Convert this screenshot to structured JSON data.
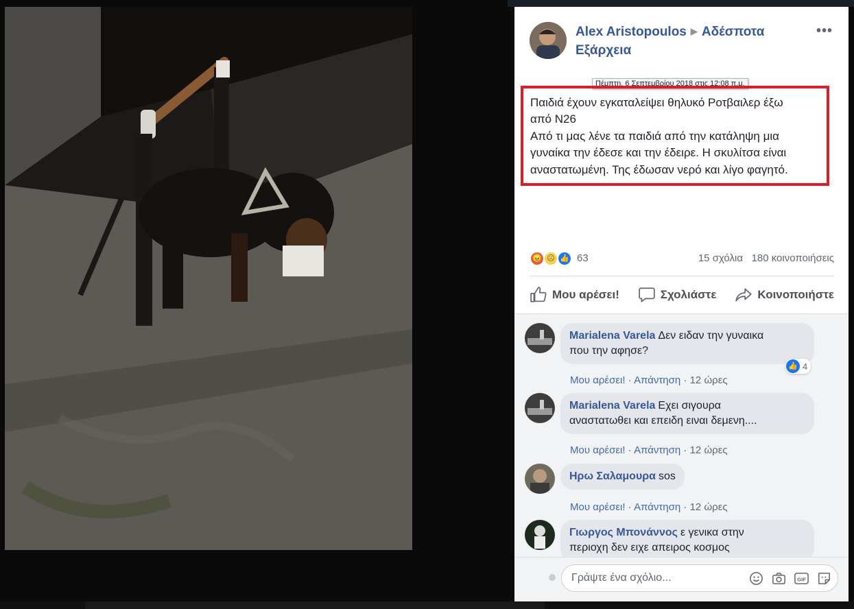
{
  "post": {
    "author": "Alex Aristopoulos",
    "group": "Αδέσποτα Εξάρχεια",
    "timestamp_tooltip": "Πέμπτη, 6 Σεπτεμβρίου 2018 στις 12:08 π.μ.",
    "more_icon": "more-horizontal-icon",
    "text_lines": [
      "Παιδιά έχουν εγκαταλείψει θηλυκό Ροτβαιλερ έξω",
      "από Ν26",
      "Από τι μας λένε τα παιδιά από την κατάληψη μια",
      "γυναίκα την έδεσε και την έδειρε. Η σκυλίτσα είναι",
      "αναστατωμένη. Της έδωσαν νερό και λίγο φαγητό."
    ],
    "highlight_color": "#e01b24"
  },
  "stats": {
    "reactions": [
      "angry",
      "sad",
      "like"
    ],
    "reaction_count": "63",
    "comments": "15 σχόλια",
    "shares": "180 κοινοποιήσεις"
  },
  "actions": {
    "like": "Μου αρέσει!",
    "comment": "Σχολιάστε",
    "share": "Κοινοποιήστε"
  },
  "comments": [
    {
      "name": "Marialena Varela",
      "text_line1": "Δεν ειδαν την γυναικα",
      "text_line2": "που την αφησε?",
      "like_label": "Μου αρέσει!",
      "reply_label": "Απάντηση",
      "time": "12 ώρες",
      "likes": "4"
    },
    {
      "name": "Marialena Varela",
      "text_line1": "Εχει σιγουρα",
      "text_line2": "αναστατωθει και επειδη ειναι δεμενη....",
      "like_label": "Μου αρέσει!",
      "reply_label": "Απάντηση",
      "time": "12 ώρες"
    },
    {
      "name": "Ηρω Σαλαμουρα",
      "text_line1": "sos",
      "like_label": "Μου αρέσει!",
      "reply_label": "Απάντηση",
      "time": "12 ώρες"
    },
    {
      "name": "Γιωργος Μπονάννος",
      "text_line1": "ε γενικα στην",
      "text_line2": "περιοχη δεν ειχε απειρος κοσμος"
    }
  ],
  "composer": {
    "placeholder": "Γράψτε ένα σχόλιο...",
    "tools": [
      "emoji-icon",
      "camera-icon",
      "gif-icon",
      "sticker-icon"
    ]
  },
  "colors": {
    "link": "#365899",
    "like_blue": "#1877f2",
    "text": "#1d2129",
    "meta": "#606770"
  }
}
